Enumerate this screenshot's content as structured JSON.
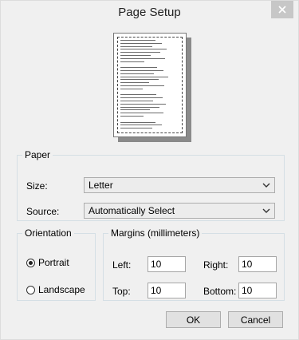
{
  "window": {
    "title": "Page Setup"
  },
  "paper": {
    "legend": "Paper",
    "size_label": "Size:",
    "size_value": "Letter",
    "source_label": "Source:",
    "source_value": "Automatically Select"
  },
  "orientation": {
    "legend": "Orientation",
    "portrait_label": "Portrait",
    "landscape_label": "Landscape",
    "selected": "Portrait"
  },
  "margins": {
    "legend": "Margins (millimeters)",
    "left_label": "Left:",
    "left_value": "10",
    "right_label": "Right:",
    "right_value": "10",
    "top_label": "Top:",
    "top_value": "10",
    "bottom_label": "Bottom:",
    "bottom_value": "10"
  },
  "buttons": {
    "ok": "OK",
    "cancel": "Cancel"
  },
  "icons": {
    "close": "close-icon",
    "dropdown": "chevron-down-icon"
  }
}
